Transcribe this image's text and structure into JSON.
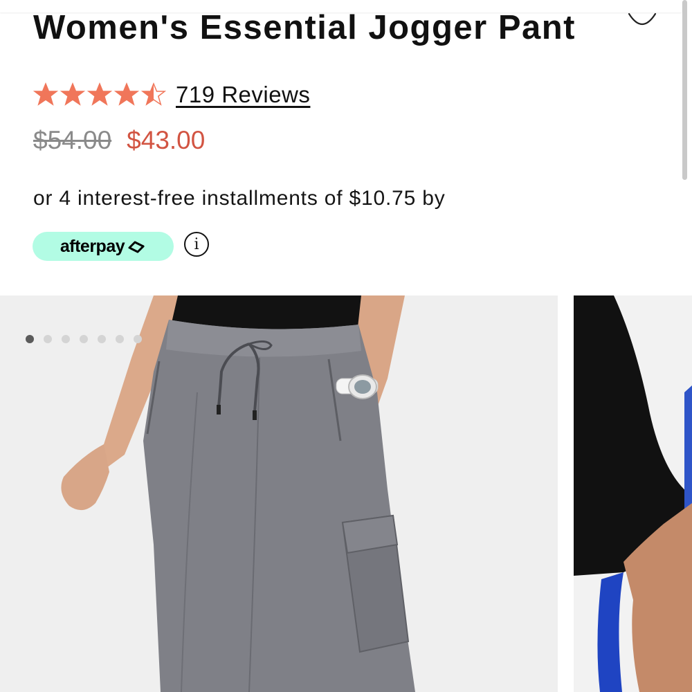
{
  "product": {
    "title": "Women's Essential Jogger Pant",
    "rating": 4.5,
    "rating_max": 5,
    "reviews_label": "719 Reviews",
    "original_price": "$54.00",
    "sale_price": "$43.00",
    "installments_text": "or 4 interest-free installments of $10.75 by",
    "afterpay_label": "afterpay",
    "info_glyph": "i"
  },
  "icons": {
    "wishlist": "heart-outline-icon",
    "star": "star-icon",
    "info": "info-circle-icon",
    "afterpay": "afterpay-arrows-icon"
  },
  "gallery": {
    "image_count": 7,
    "active_index": 0
  },
  "colors": {
    "star": "#f0765a",
    "sale_price": "#d25442",
    "afterpay_bg": "#b2fce4",
    "pants": "#7f8087",
    "shirt": "#121212"
  }
}
